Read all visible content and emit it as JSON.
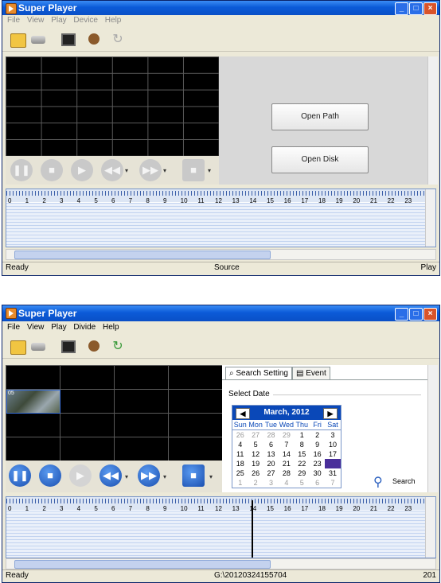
{
  "window1": {
    "title": "Super Player",
    "menu": [
      "File",
      "View",
      "Play",
      "Device",
      "Help"
    ],
    "toolbar": [
      "folder-icon",
      "device-icon",
      "monitor-icon",
      "camera-icon",
      "refresh-icon"
    ],
    "buttons": {
      "open_path": "Open Path",
      "open_disk": "Open Disk"
    },
    "ruler": [
      "0",
      "1",
      "2",
      "3",
      "4",
      "5",
      "6",
      "7",
      "8",
      "9",
      "10",
      "11",
      "12",
      "13",
      "14",
      "15",
      "16",
      "17",
      "18",
      "19",
      "20",
      "21",
      "22",
      "23"
    ],
    "status": {
      "left": "Ready",
      "middle": "Source",
      "right": "Play"
    }
  },
  "window2": {
    "title": "Super Player",
    "menu": [
      "File",
      "View",
      "Play",
      "Divide",
      "Help"
    ],
    "tabs": [
      "Search Setting",
      "Event"
    ],
    "tab_search_label": "Search Setting",
    "tab_event_label": "Event",
    "section_label": "Select Date",
    "search_label": "Search",
    "cell_label": "05",
    "calendar": {
      "month_label": "March, 2012",
      "dow": [
        "Sun",
        "Mon",
        "Tue",
        "Wed",
        "Thu",
        "Fri",
        "Sat"
      ],
      "weeks": [
        [
          "26",
          "27",
          "28",
          "29",
          "1",
          "2",
          "3"
        ],
        [
          "4",
          "5",
          "6",
          "7",
          "8",
          "9",
          "10"
        ],
        [
          "11",
          "12",
          "13",
          "14",
          "15",
          "16",
          "17"
        ],
        [
          "18",
          "19",
          "20",
          "21",
          "22",
          "23",
          "24"
        ],
        [
          "25",
          "26",
          "27",
          "28",
          "29",
          "30",
          "31"
        ],
        [
          "1",
          "2",
          "3",
          "4",
          "5",
          "6",
          "7"
        ]
      ],
      "selected": "24"
    },
    "ruler": [
      "0",
      "1",
      "2",
      "3",
      "4",
      "5",
      "6",
      "7",
      "8",
      "9",
      "10",
      "11",
      "12",
      "13",
      "14",
      "15",
      "16",
      "17",
      "18",
      "19",
      "20",
      "21",
      "22",
      "23"
    ],
    "status": {
      "left": "Ready",
      "middle": "G:\\20120324155704",
      "right": "201"
    }
  },
  "colors": {
    "titlebar": "#0b5bd8",
    "accent": "#1a4fb0",
    "selected_day": "#4a2e9a"
  }
}
